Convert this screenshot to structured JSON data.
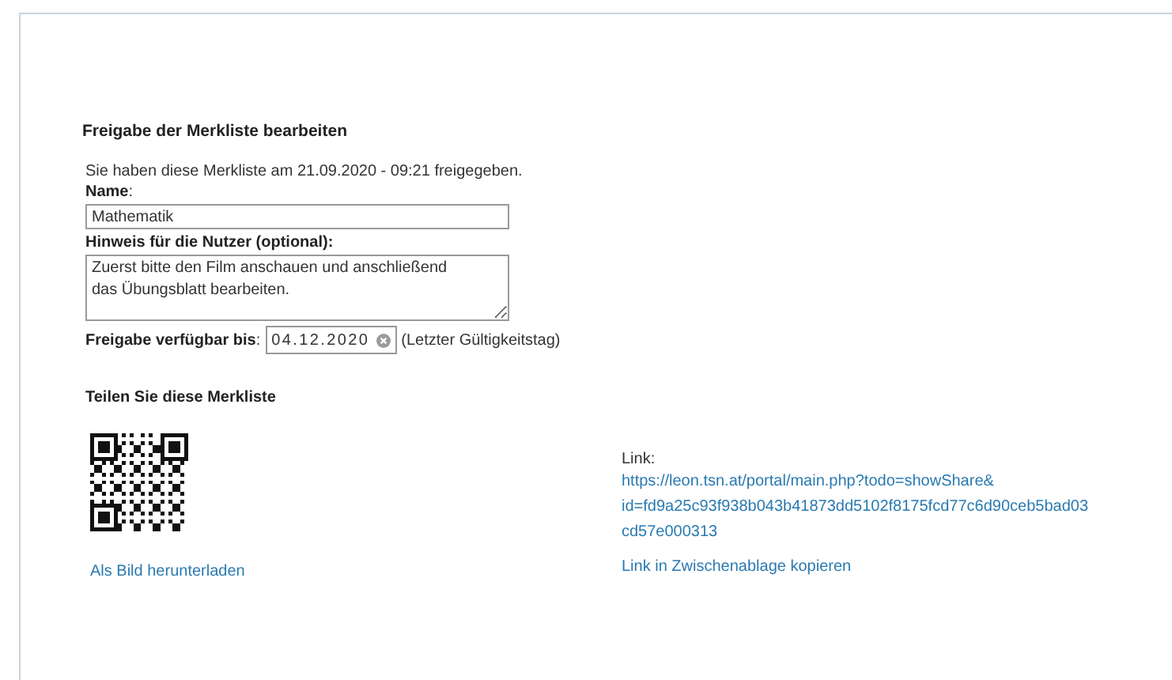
{
  "heading": "Freigabe der Merkliste bearbeiten",
  "info": "Sie haben diese Merkliste am 21.09.2020 - 09:21 freigegeben.",
  "name_field": {
    "label": "**Name**:",
    "value": "Mathematik"
  },
  "hint_field": {
    "label": "Hinweis für die Nutzer (optional):",
    "value": "Zuerst bitte den Film anschauen und anschließend\ndas Übungsblatt bearbeiten."
  },
  "date_field": {
    "label": "**Freigabe verfügbar bis**:",
    "value": "04.12.2020",
    "note": "(Letzter Gültigkeitstag)"
  },
  "share": {
    "heading": "Teilen Sie diese Merkliste",
    "download_link": "Als Bild herunterladen",
    "link_label": "Link:",
    "link_lines": [
      "https://leon.tsn.at/portal/main.php?todo=showShare&",
      "id=fd9a25c93f938b043b41873dd5102f8175fcd77c6d90ceb5bad03",
      "cd57e000313"
    ],
    "copy_link": "Link in Zwischenablage kopieren"
  }
}
